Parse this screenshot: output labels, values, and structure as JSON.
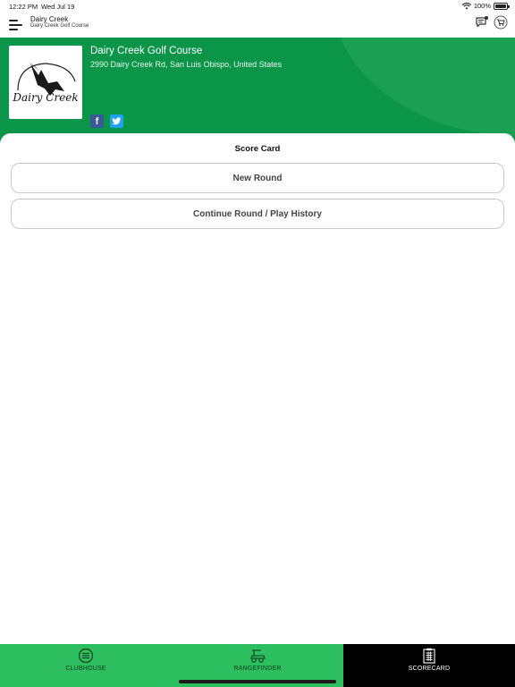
{
  "status_bar": {
    "time": "12:22 PM",
    "date": "Wed Jul 19",
    "battery": "100%",
    "icons": [
      "wifi-icon",
      "battery-icon"
    ]
  },
  "header": {
    "title": "Dairy Creek",
    "subtitle": "Dairy Creek Golf Course",
    "icons": [
      "menu-icon",
      "chat-icon",
      "cart-icon"
    ]
  },
  "course": {
    "name": "Dairy Creek Golf Course",
    "address": "2990 Dairy Creek Rd, San Luis Obispo, United States",
    "logo_text": "Dairy Creek",
    "social": [
      "facebook-icon",
      "twitter-icon"
    ]
  },
  "scorecard": {
    "title": "Score Card",
    "new_round_label": "New Round",
    "continue_label": "Continue Round / Play History"
  },
  "tabs": [
    {
      "label": "CLUBHOUSE",
      "icon": "menu-circle-icon",
      "active": false
    },
    {
      "label": "RANGEFINDER",
      "icon": "golf-cart-icon",
      "active": false
    },
    {
      "label": "SCORECARD",
      "icon": "clipboard-icon",
      "active": true
    }
  ],
  "colors": {
    "hero_green": "#0a9548",
    "tab_green": "#2dbf5f",
    "tab_active_bg": "#000000",
    "facebook": "#3b5998",
    "twitter": "#1da1f2"
  }
}
